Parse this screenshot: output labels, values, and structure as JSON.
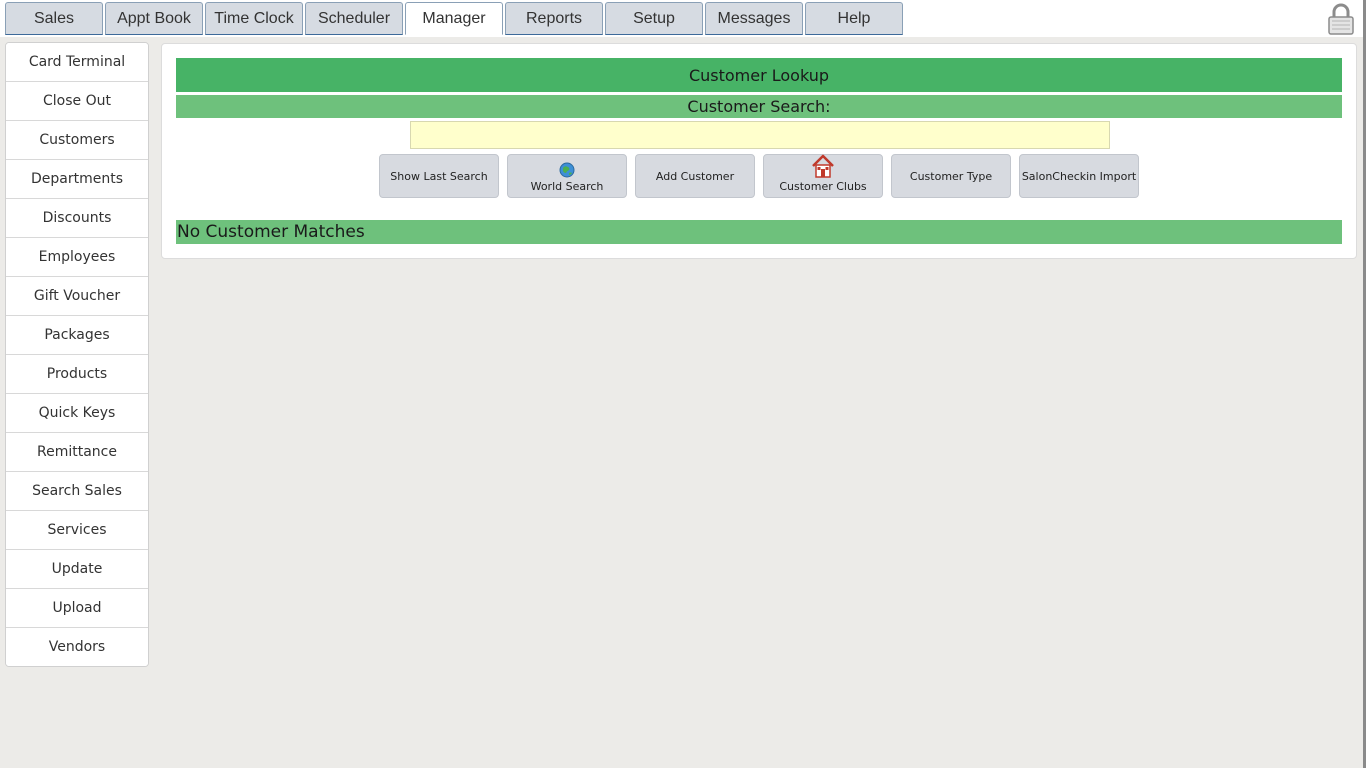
{
  "top_tabs": [
    {
      "label": "Sales"
    },
    {
      "label": "Appt Book"
    },
    {
      "label": "Time Clock"
    },
    {
      "label": "Scheduler"
    },
    {
      "label": "Manager",
      "active": true
    },
    {
      "label": "Reports"
    },
    {
      "label": "Setup"
    },
    {
      "label": "Messages"
    },
    {
      "label": "Help"
    }
  ],
  "lock_icon": "padlock-icon",
  "sidebar": {
    "items": [
      "Card Terminal",
      "Close Out",
      "Customers",
      "Departments",
      "Discounts",
      "Employees",
      "Gift Voucher",
      "Packages",
      "Products",
      "Quick Keys",
      "Remittance",
      "Search Sales",
      "Services",
      "Update",
      "Upload",
      "Vendors"
    ]
  },
  "panel": {
    "title": "Customer Lookup",
    "search_label": "Customer Search:",
    "search_value": "",
    "buttons": [
      {
        "label": "Show Last Search",
        "icon": null
      },
      {
        "label": "World Search",
        "icon": "globe-icon"
      },
      {
        "label": "Add Customer",
        "icon": null
      },
      {
        "label": "Customer Clubs",
        "icon": "house-icon"
      },
      {
        "label": "Customer Type",
        "icon": null
      },
      {
        "label": "SalonCheckin Import",
        "icon": null
      }
    ],
    "result_text": "No Customer Matches"
  },
  "colors": {
    "title_bar": "#47b366",
    "sub_bar": "#6ec17c",
    "input_bg": "#ffffcc",
    "page_bg": "#ecebe8"
  }
}
